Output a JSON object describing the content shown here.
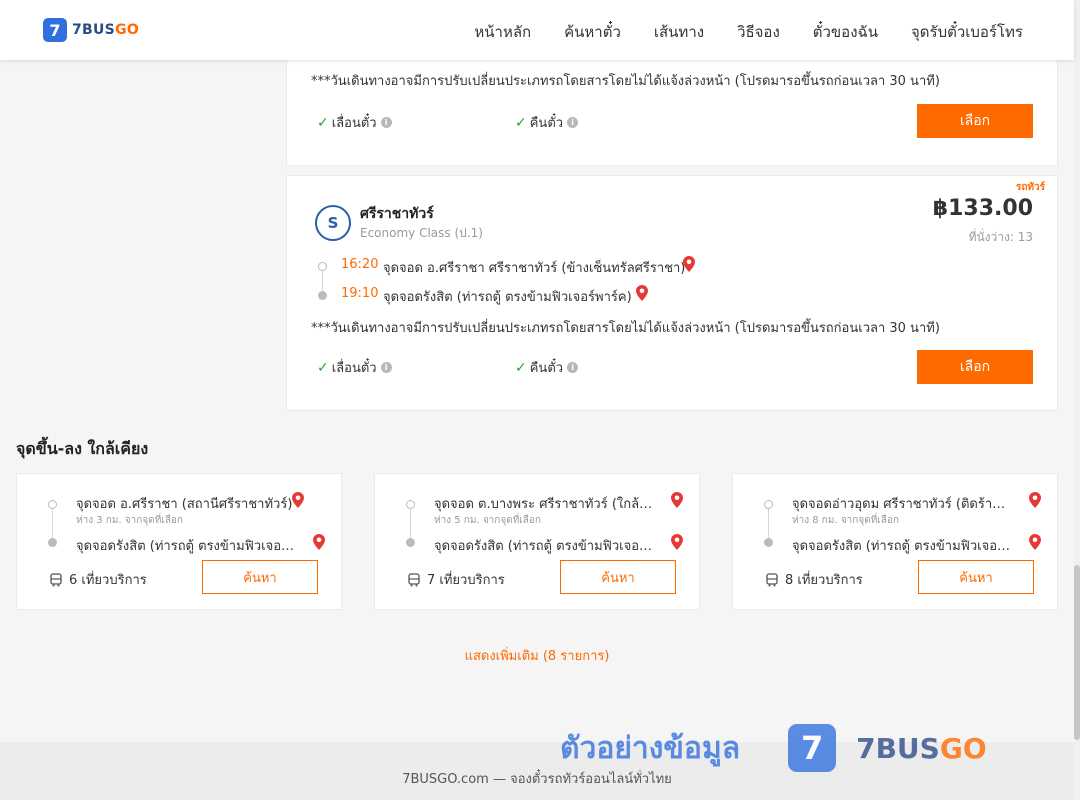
{
  "header": {
    "logo_mark": "7",
    "logo_brand": "7BUS",
    "logo_brand_accent": "GO",
    "nav": [
      "หน้าหลัก",
      "ค้นหาตั๋ว",
      "เส้นทาง",
      "วิธีจอง",
      "ตั๋วของฉัน",
      "จุดรับตั๋วเบอร์โทร"
    ]
  },
  "top_card": {
    "notice": "***วันเดินทางอาจมีการปรับเปลี่ยนประเภทรถโดยสารโดยไม่ได้แจ้งล่วงหน้า (โปรดมารอขึ้นรถก่อนเวลา 30 นาที)",
    "feature_reschedule": "เลื่อนตั๋ว",
    "feature_refund": "คืนตั๋ว",
    "select_label": "เลือก"
  },
  "main_card": {
    "badge": "รถทัวร์",
    "operator_logo": "S",
    "operator_name": "ศรีราชาทัวร์",
    "bus_class": "Economy Class (ป.1)",
    "price": "฿133.00",
    "seats": "ที่นั่งว่าง: 13",
    "departure_time": "16:20",
    "departure_stop": "จุดจอด อ.ศรีราชา ศรีราชาทัวร์ (ข้างเซ็นทรัลศรีราชา)",
    "arrival_time": "19:10",
    "arrival_stop": "จุดจอดรังสิต (ท่ารถตู้ ตรงข้ามฟิวเจอร์พาร์ค)",
    "notice": "***วันเดินทางอาจมีการปรับเปลี่ยนประเภทรถโดยสารโดยไม่ได้แจ้งล่วงหน้า (โปรดมารอขึ้นรถก่อนเวลา 30 นาที)",
    "feature_reschedule": "เลื่อนตั๋ว",
    "feature_refund": "คืนตั๋ว",
    "select_label": "เลือก"
  },
  "nearby": {
    "title": "จุดขึ้น-ลง ใกล้เคียง",
    "items": [
      {
        "from": "จุดจอด อ.ศรีราชา (สถานีศรีราชาทัวร์)",
        "distance": "ห่าง 3 กม. จากจุดที่เลือก",
        "to": "จุดจอดรังสิต (ท่ารถตู้ ตรงข้ามฟิวเจอร์...",
        "trips": "6 เที่ยวบริการ",
        "search_label": "ค้นหา"
      },
      {
        "from": "จุดจอด ต.บางพระ ศรีราชาทัวร์ (ใกล้ร้า...",
        "distance": "ห่าง 5 กม. จากจุดที่เลือก",
        "to": "จุดจอดรังสิต (ท่ารถตู้ ตรงข้ามฟิวเจอร์...",
        "trips": "7 เที่ยวบริการ",
        "search_label": "ค้นหา"
      },
      {
        "from": "จุดจอดอ่าวอุดม ศรีราชาทัวร์ (ติดร้านท...",
        "distance": "ห่าง 8 กม. จากจุดที่เลือก",
        "to": "จุดจอดรังสิต (ท่ารถตู้ ตรงข้ามฟิวเจอร์...",
        "trips": "8 เที่ยวบริการ",
        "search_label": "ค้นหา"
      }
    ],
    "show_more": "แสดงเพิ่มเติม (8 รายการ)"
  },
  "footer": {
    "text": "7BUSGO.com — จองตั๋วรถทัวร์ออนไลน์ทั่วไทย"
  },
  "watermark": {
    "text": "ตัวอย่างข้อมูล",
    "logo_mark": "7",
    "brand": "7BUS",
    "brand_accent": "GO"
  },
  "colors": {
    "accent": "#ff6a00",
    "brand_blue": "#2f6fde",
    "check_green": "#2ca02c",
    "pin_red": "#e53935"
  }
}
